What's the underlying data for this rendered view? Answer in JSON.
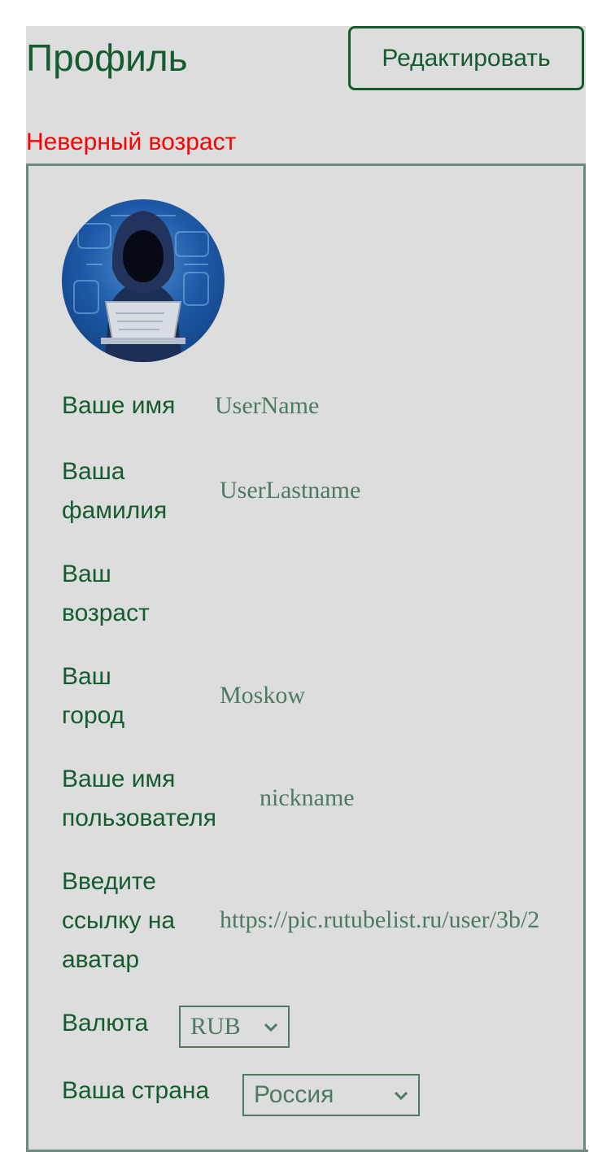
{
  "header": {
    "title": "Профиль",
    "edit_label": "Редактировать"
  },
  "error_message": "Неверный возраст",
  "profile": {
    "fields": [
      {
        "label": "Ваше имя",
        "value": "UserName"
      },
      {
        "label": "Ваша фамилия",
        "value": "UserLastname"
      },
      {
        "label": "Ваш возраст",
        "value": ""
      },
      {
        "label": "Ваш город",
        "value": "Moskow"
      },
      {
        "label": "Ваше имя пользователя",
        "value": "nickname"
      },
      {
        "label": "Введите ссылку на аватар",
        "value": "https://pic.rutubelist.ru/user/3b/2"
      }
    ],
    "currency": {
      "label": "Валюта",
      "selected": "RUB"
    },
    "country": {
      "label": "Ваша страна",
      "selected": "Россия"
    }
  },
  "colors": {
    "accent": "#145c2e",
    "error": "#ff0000",
    "panel": "#dddddd",
    "border": "#6a8a80"
  }
}
